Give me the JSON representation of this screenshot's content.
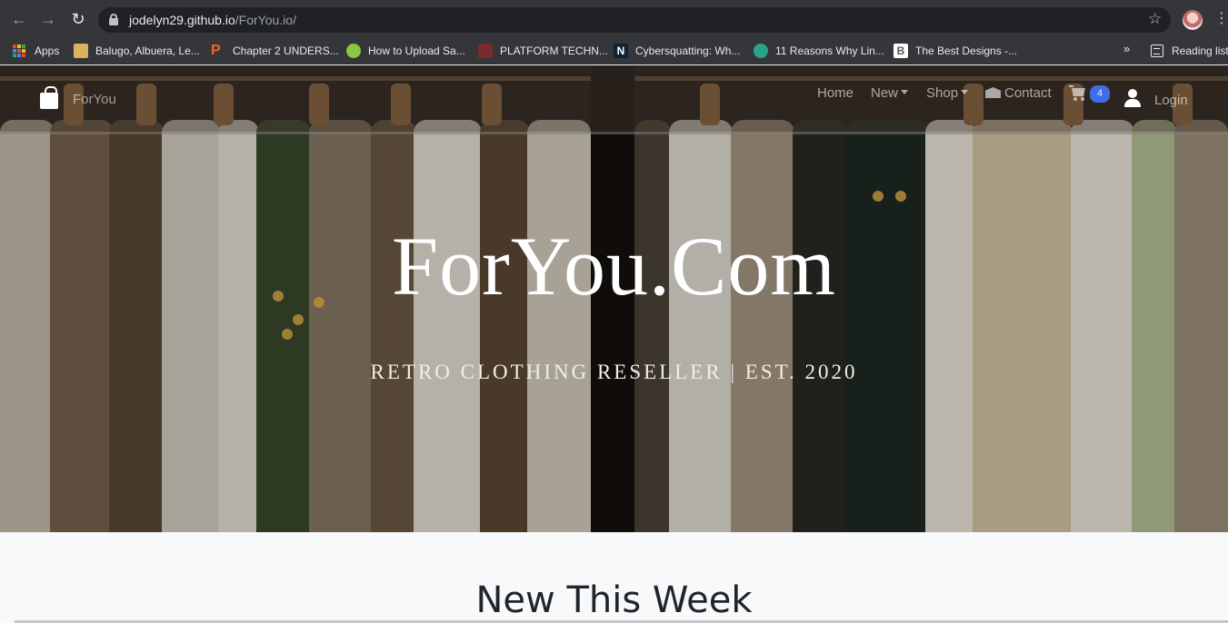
{
  "browser": {
    "url_host": "jodelyn29.github.io",
    "url_path": "/ForYou.io/",
    "bookmarks": [
      {
        "label": "Apps",
        "icon": "apps-grid-icon"
      },
      {
        "label": "Balugo, Albuera, Le...",
        "icon": "site-favicon"
      },
      {
        "label": "Chapter 2 UNDERS...",
        "icon": "p-favicon"
      },
      {
        "label": "How to Upload Sa...",
        "icon": "site-favicon"
      },
      {
        "label": "PLATFORM TECHN...",
        "icon": "site-favicon"
      },
      {
        "label": "Cybersquatting: Wh...",
        "icon": "n-favicon"
      },
      {
        "label": "11 Reasons Why Lin...",
        "icon": "site-favicon"
      },
      {
        "label": "The Best Designs -...",
        "icon": "b-favicon"
      }
    ],
    "more_bookmarks": "»",
    "reading_list": "Reading list"
  },
  "navbar": {
    "brand": "ForYou",
    "links": {
      "home": "Home",
      "new": "New",
      "shop": "Shop",
      "contact": "Contact"
    },
    "cart_count": "4",
    "login": "Login"
  },
  "hero": {
    "title": "ForYou.Com",
    "subtitle": "RETRO CLOTHING RESELLER | EST. 2020"
  },
  "section": {
    "title": "New This Week"
  },
  "colors": {
    "accent_badge": "#3d6ee8",
    "chrome_bg": "#35363a",
    "omnibox_bg": "#202124"
  }
}
